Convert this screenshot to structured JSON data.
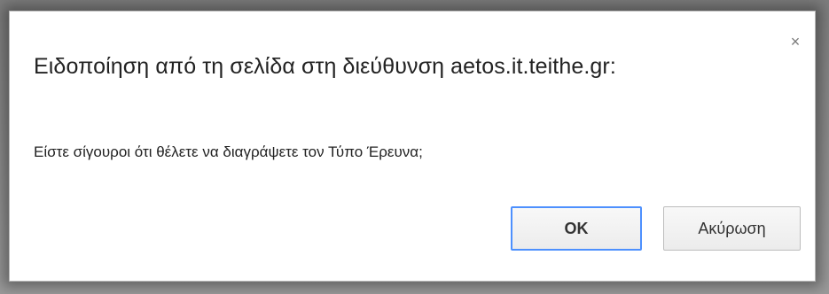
{
  "dialog": {
    "title": "Ειδοποίηση από τη σελίδα στη διεύθυνση aetos.it.teithe.gr:",
    "close_symbol": "×",
    "message": "Είστε σίγουροι ότι θέλετε να διαγράψετε τον Τύπο Έρευνα;",
    "ok_label": "OK",
    "cancel_label": "Ακύρωση"
  },
  "colors": {
    "focus_border": "#4d90fe",
    "text": "#222222"
  }
}
